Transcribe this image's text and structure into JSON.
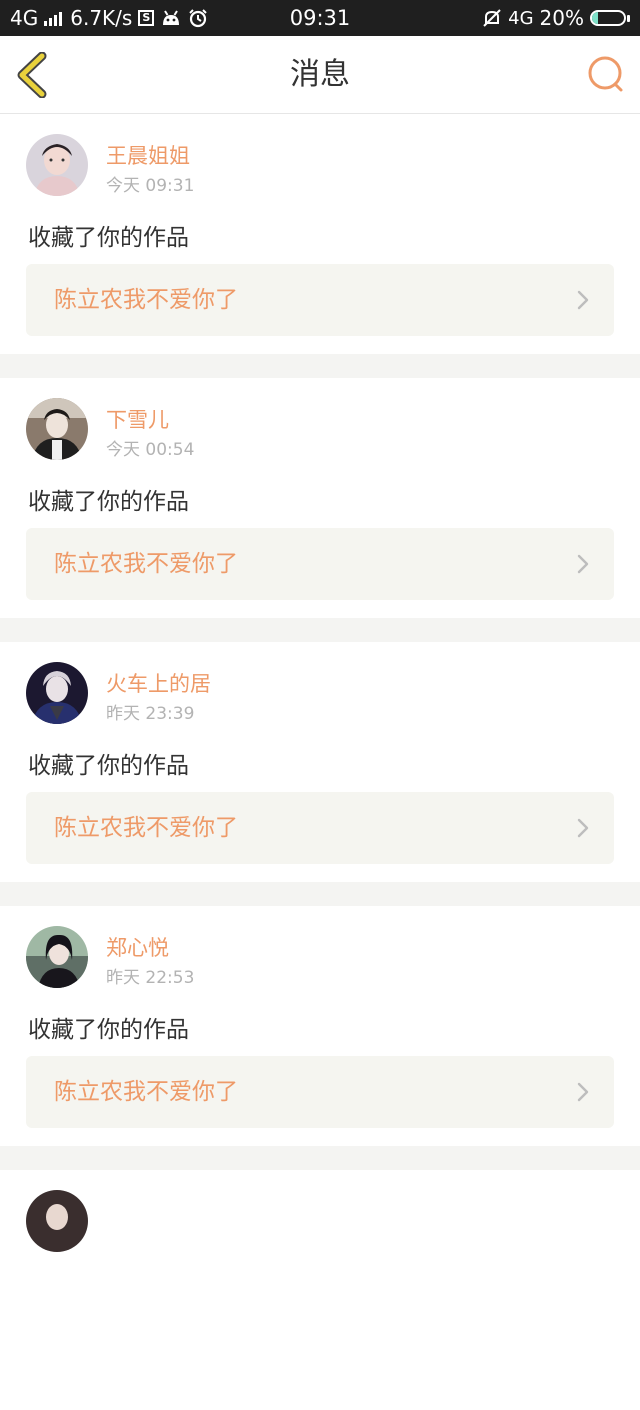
{
  "status_bar": {
    "network_left": "4G",
    "speed": "6.7K/s",
    "s_badge": "S",
    "time": "09:31",
    "network_right": "4G",
    "battery_percent": "20%",
    "battery_level": 0.2,
    "icons": [
      "signal-bars-icon",
      "s-badge-icon",
      "android-icon",
      "alarm-icon",
      "mute-icon",
      "battery-icon"
    ]
  },
  "header": {
    "title": "消息",
    "back_icon": "chevron-left-icon",
    "search_icon": "search-icon"
  },
  "messages": [
    {
      "name": "王晨姐姐",
      "time": "今天 09:31",
      "action": "收藏了你的作品",
      "work_title": "陈立农我不爱你了"
    },
    {
      "name": "下雪儿",
      "time": "今天 00:54",
      "action": "收藏了你的作品",
      "work_title": "陈立农我不爱你了"
    },
    {
      "name": "火车上的居",
      "time": "昨天 23:39",
      "action": "收藏了你的作品",
      "work_title": "陈立农我不爱你了"
    },
    {
      "name": "郑心悦",
      "time": "昨天 22:53",
      "action": "收藏了你的作品",
      "work_title": "陈立农我不爱你了"
    }
  ],
  "colors": {
    "accent": "#ee9a68",
    "status_bar": "#1f1f1f",
    "card_link_bg": "#f5f5f0",
    "separator": "#f4f4f2",
    "back_icon": "#e9d23c"
  }
}
